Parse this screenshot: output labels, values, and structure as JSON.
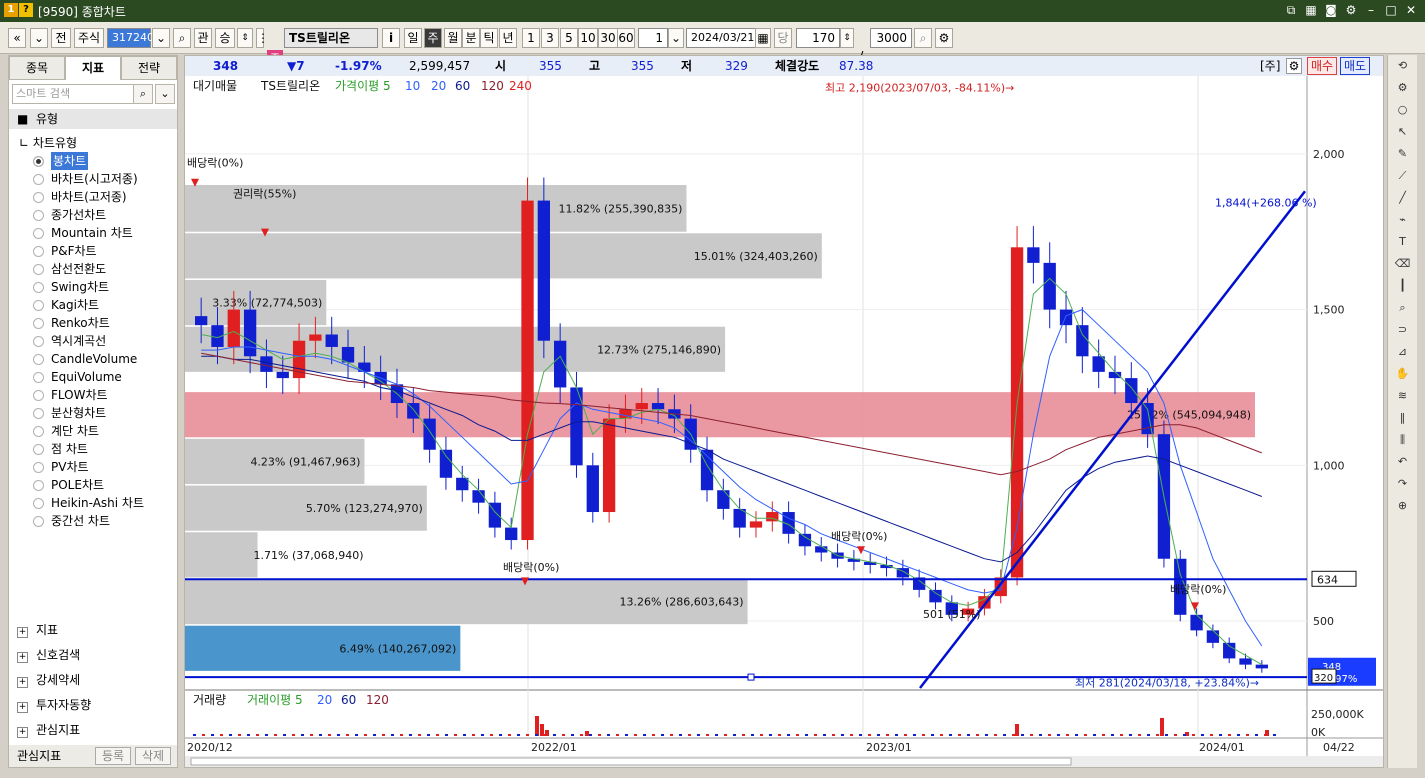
{
  "window": {
    "title": "[9590] 종합차트"
  },
  "toolbar": {
    "nav_first": "«",
    "nav_down": "»",
    "stock_btn": "전",
    "type": "주식",
    "code": "317240",
    "gwan": "관",
    "sang": "승",
    "badge": "증",
    "name": "TS트릴리온",
    "info": "i",
    "periods": [
      "일",
      "주",
      "월",
      "분",
      "틱",
      "년"
    ],
    "nums": [
      "1",
      "3",
      "5",
      "10",
      "30",
      "60"
    ],
    "count": "1",
    "date": "2024/03/21",
    "dang": "당",
    "bars": "170",
    "slash": "/",
    "total": "3000"
  },
  "left": {
    "tabs": [
      "종목",
      "지표",
      "전략"
    ],
    "search_placeholder": "스마트 검색",
    "section": "유형",
    "chart_type_label": "차트유형",
    "items": [
      "봉차트",
      "바차트(시고저종)",
      "바차트(고저종)",
      "종가선차트",
      "Mountain 차트",
      "P&F차트",
      "삼선전환도",
      "Swing차트",
      "Kagi차트",
      "Renko차트",
      "역시계곡선",
      "CandleVolume",
      "EquiVolume",
      "FLOW차트",
      "분산형차트",
      "계단 차트",
      "점 차트",
      "PV차트",
      "POLE차트",
      "Heikin-Ashi 차트",
      "중간선 차트"
    ],
    "bottom": [
      "지표",
      "신호검색",
      "강세약세",
      "투자자동향",
      "관심지표"
    ],
    "fav_label": "관심지표",
    "reg": "등록",
    "del": "삭제"
  },
  "info": {
    "price": "348",
    "change": "▼7",
    "pct": "-1.97%",
    "volume": "2,599,457",
    "open_l": "시",
    "open": "355",
    "high_l": "고",
    "high": "355",
    "low_l": "저",
    "low": "329",
    "str_l": "체결강도",
    "str": "87.38",
    "ju": "[주]",
    "buy": "매수",
    "sell": "매도"
  },
  "legend": {
    "main": "대기매물",
    "name": "TS트릴리온",
    "ma": "가격이평 5",
    "ma10": "10",
    "ma20": "20",
    "ma60": "60",
    "ma120": "120",
    "ma240": "240",
    "vol": "거래량",
    "vma": "거래이평 5",
    "v20": "20",
    "v60": "60",
    "v120": "120"
  },
  "colors": {
    "up": "#e02020",
    "down": "#1020d0",
    "pink": "#e8909a",
    "gray": "#c4c4c4",
    "blue": "#3b8dc8",
    "line": "#0010d0"
  },
  "chart_data": {
    "type": "candlestick",
    "y_ticks": [
      "2,000",
      "1,500",
      "1,000",
      "500"
    ],
    "y_vals": [
      2000,
      1500,
      1000,
      500
    ],
    "ylim": [
      285,
      2250
    ],
    "x_ticks": [
      "2020/12",
      "2022/01",
      "2023/01",
      "2024/01",
      "04/22"
    ],
    "vol_ticks": [
      "250,000K",
      "0K"
    ],
    "volume_profile": [
      {
        "label": "11.82% (255,390,835)",
        "lo": 1750,
        "hi": 1900,
        "pct": 11.82
      },
      {
        "label": "15.01% (324,403,260)",
        "lo": 1600,
        "hi": 1745,
        "pct": 15.01
      },
      {
        "label": "3.33% (72,774,503)",
        "lo": 1450,
        "hi": 1595,
        "pct": 3.33
      },
      {
        "label": "12.73% (275,146,890)",
        "lo": 1300,
        "hi": 1445,
        "pct": 12.73
      },
      {
        "label": "25.22% (545,094,948)",
        "lo": 1090,
        "hi": 1235,
        "pct": 25.22
      },
      {
        "label": "4.23% (91,467,963)",
        "lo": 940,
        "hi": 1085,
        "pct": 4.23
      },
      {
        "label": "5.70% (123,274,970)",
        "lo": 790,
        "hi": 935,
        "pct": 5.7
      },
      {
        "label": "1.71% (37,068,940)",
        "lo": 640,
        "hi": 785,
        "pct": 1.71
      },
      {
        "label": "13.26% (286,603,643)",
        "lo": 490,
        "hi": 635,
        "pct": 13.26
      },
      {
        "label": "6.49% (140,267,092)",
        "lo": 340,
        "hi": 485,
        "pct": 6.49
      }
    ],
    "annotations": [
      "배당락(0%)",
      "권리락(55%)",
      "배당락(0%)",
      "배당락(0%)",
      "배당락(0%)",
      "501 (51%)"
    ],
    "high_label": "최고 2,190(2023/07/03, -84.11%)→",
    "low_label": "최저 281(2024/03/18, +23.84%)→",
    "trend_label": "1,844(+268.06 %)",
    "hline1": "634",
    "hline2": "320",
    "price_tag": "348",
    "price_pct": "-1.97%",
    "closes": [
      1450,
      1380,
      1500,
      1350,
      1300,
      1280,
      1400,
      1420,
      1380,
      1330,
      1300,
      1260,
      1200,
      1150,
      1050,
      960,
      920,
      880,
      800,
      760,
      1850,
      1400,
      1250,
      1000,
      850,
      1150,
      1180,
      1200,
      1180,
      1150,
      1050,
      920,
      860,
      800,
      820,
      850,
      780,
      740,
      720,
      700,
      690,
      680,
      670,
      640,
      600,
      560,
      520,
      540,
      580,
      640,
      1700,
      1650,
      1500,
      1450,
      1350,
      1300,
      1280,
      1200,
      1100,
      700,
      520,
      470,
      430,
      380,
      360,
      348
    ],
    "ma5": [
      1420,
      1410,
      1430,
      1400,
      1370,
      1340,
      1350,
      1360,
      1350,
      1330,
      1300,
      1270,
      1230,
      1180,
      1110,
      1030,
      970,
      920,
      850,
      800,
      1100,
      1300,
      1350,
      1250,
      1100,
      1150,
      1150,
      1170,
      1180,
      1160,
      1100,
      1000,
      920,
      860,
      830,
      830,
      810,
      770,
      740,
      710,
      700,
      690,
      680,
      660,
      630,
      590,
      560,
      550,
      570,
      620,
      1200,
      1550,
      1600,
      1550,
      1420,
      1360,
      1300,
      1250,
      1180,
      900,
      650,
      520,
      470,
      420,
      390,
      360
    ],
    "ma20": [
      1370,
      1370,
      1380,
      1380,
      1370,
      1360,
      1350,
      1350,
      1340,
      1320,
      1300,
      1280,
      1260,
      1230,
      1190,
      1140,
      1090,
      1040,
      990,
      940,
      950,
      1050,
      1150,
      1200,
      1180,
      1170,
      1160,
      1150,
      1140,
      1120,
      1080,
      1030,
      980,
      930,
      890,
      860,
      830,
      810,
      780,
      760,
      740,
      720,
      700,
      680,
      660,
      640,
      620,
      600,
      590,
      600,
      800,
      1100,
      1350,
      1480,
      1500,
      1450,
      1400,
      1350,
      1300,
      1200,
      1000,
      850,
      700,
      600,
      500,
      420
    ],
    "ma60": [
      1350,
      1350,
      1340,
      1340,
      1330,
      1320,
      1310,
      1300,
      1290,
      1280,
      1270,
      1250,
      1240,
      1220,
      1200,
      1180,
      1160,
      1130,
      1110,
      1080,
      1080,
      1100,
      1120,
      1140,
      1140,
      1130,
      1120,
      1110,
      1100,
      1090,
      1070,
      1050,
      1020,
      1000,
      980,
      960,
      940,
      920,
      900,
      880,
      860,
      840,
      820,
      800,
      780,
      760,
      740,
      720,
      700,
      690,
      720,
      780,
      850,
      920,
      960,
      990,
      1010,
      1020,
      1030,
      1020,
      1000,
      980,
      960,
      940,
      920,
      900
    ],
    "ma120": [
      1360,
      1350,
      1340,
      1330,
      1320,
      1310,
      1300,
      1290,
      1280,
      1270,
      1265,
      1260,
      1255,
      1250,
      1240,
      1235,
      1230,
      1225,
      1220,
      1210,
      1205,
      1200,
      1198,
      1195,
      1190,
      1185,
      1180,
      1175,
      1170,
      1165,
      1160,
      1150,
      1140,
      1130,
      1120,
      1110,
      1100,
      1090,
      1080,
      1070,
      1060,
      1050,
      1040,
      1030,
      1020,
      1010,
      1000,
      990,
      980,
      970,
      980,
      1000,
      1020,
      1050,
      1070,
      1090,
      1100,
      1110,
      1120,
      1130,
      1130,
      1120,
      1100,
      1080,
      1060,
      1040
    ]
  }
}
